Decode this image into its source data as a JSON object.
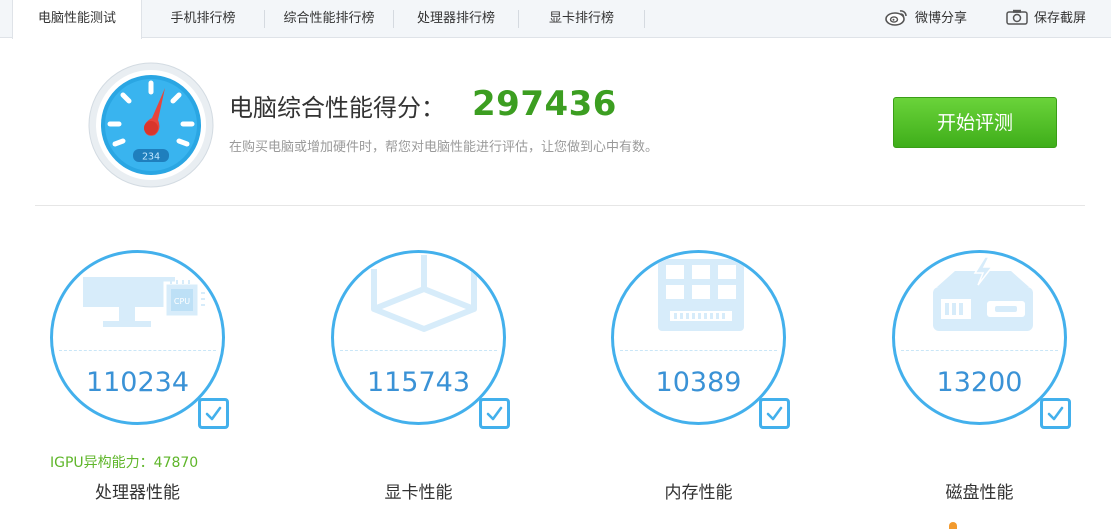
{
  "tabs": [
    {
      "label": "电脑性能测试",
      "active": true
    },
    {
      "label": "手机排行榜"
    },
    {
      "label": "综合性能排行榜"
    },
    {
      "label": "处理器排行榜"
    },
    {
      "label": "显卡排行榜"
    }
  ],
  "share": {
    "weibo": "微博分享",
    "screenshot": "保存截屏"
  },
  "gauge": {
    "reading": "234"
  },
  "header": {
    "title": "电脑综合性能得分：",
    "score": "297436",
    "subtitle": "在购买电脑或增加硬件时，帮您对电脑性能进行评估，让您做到心中有数。",
    "start_button": "开始评测"
  },
  "cards": [
    {
      "label": "处理器性能",
      "value": "110234",
      "extra": "IGPU异构能力：47870",
      "icon": "monitor-cpu-icon",
      "chip_text": "CPU"
    },
    {
      "label": "显卡性能",
      "value": "115743",
      "icon": "graphics-cube-icon"
    },
    {
      "label": "内存性能",
      "value": "10389",
      "icon": "memory-chip-icon"
    },
    {
      "label": "磁盘性能",
      "value": "13200",
      "icon": "disk-drive-icon"
    }
  ],
  "colors": {
    "accent": "#43b0ec",
    "score_green": "#3c9e21",
    "button_green": "#4cbf22",
    "extra_green": "#5fb62a",
    "value_blue": "#3a92d6"
  }
}
